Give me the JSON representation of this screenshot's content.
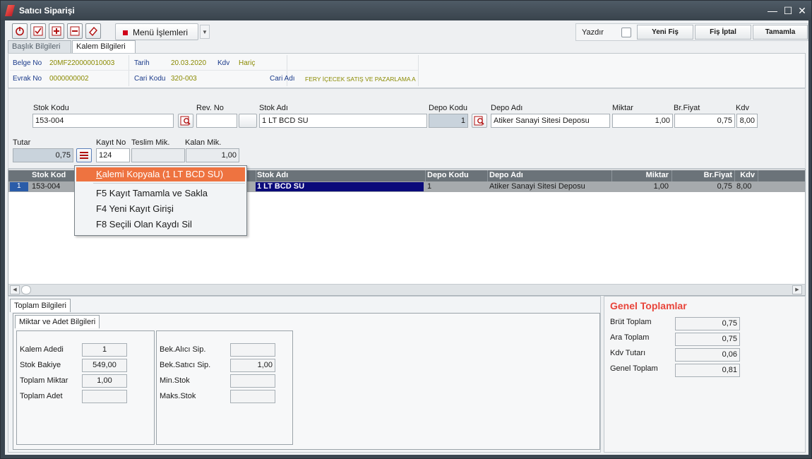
{
  "window": {
    "title": "Satıcı Siparişi",
    "minimize": "—",
    "maximize": "☐",
    "close": "✕"
  },
  "toolbar": {
    "menu_label": "Menü İşlemleri",
    "print_label": "Yazdır",
    "new_label": "Yeni Fiş",
    "cancel_label": "Fiş İptal",
    "complete_label": "Tamamla"
  },
  "tabs": [
    "Başlık Bilgileri",
    "Kalem Bilgileri"
  ],
  "header": {
    "belge_no_label": "Belge No",
    "belge_no": "20MF220000010003",
    "tarih_label": "Tarih",
    "tarih": "20.03.2020",
    "kdv_label": "Kdv",
    "kdv": "Hariç",
    "evrak_no_label": "Evrak No",
    "evrak_no": "0000000002",
    "cari_kodu_label": "Cari Kodu",
    "cari_kodu": "320-003",
    "cari_adi_label": "Cari Adı",
    "cari_adi": "FERY İÇECEK SATIŞ VE PAZARLAMA A"
  },
  "entry": {
    "stok_kodu_label": "Stok Kodu",
    "stok_kodu": "153-004",
    "rev_no_label": "Rev. No",
    "rev_no": "",
    "stok_adi_label": "Stok Adı",
    "stok_adi": "1 LT BCD SU",
    "depo_kodu_label": "Depo Kodu",
    "depo_kodu": "1",
    "depo_adi_label": "Depo Adı",
    "depo_adi": "Atiker Sanayi Sitesi Deposu",
    "miktar_label": "Miktar",
    "miktar": "1,00",
    "br_fiyat_label": "Br.Fiyat",
    "br_fiyat": "0,75",
    "kdv_label": "Kdv",
    "kdv": "8,00",
    "tutar_label": "Tutar",
    "tutar": "0,75",
    "kayit_no_label": "Kayıt No",
    "kayit_no": "124",
    "teslim_label": "Teslim Mik.",
    "teslim": "",
    "kalan_label": "Kalan Mik.",
    "kalan": "1,00"
  },
  "grid": {
    "columns": [
      "Stok Kod",
      "Stok Adı",
      "Depo Kodu",
      "Depo Adı",
      "Miktar",
      "Br.Fiyat",
      "Kdv"
    ],
    "rows": [
      {
        "num": "1",
        "stok_kodu": "153-004",
        "stok_adi": "1 LT BCD SU",
        "depo_kodu": "1",
        "depo_adi": "Atiker Sanayi Sitesi Deposu",
        "miktar": "1,00",
        "br_fiyat": "0,75",
        "kdv": "8,00"
      }
    ]
  },
  "context_menu": {
    "items": [
      {
        "key": "K",
        "label": "alemi Kopyala (1 LT BCD SU)"
      },
      {
        "key": "F5",
        "label": " Kayıt Tamamla ve Sakla"
      },
      {
        "key": "F4",
        "label": " Yeni Kayıt Girişi"
      },
      {
        "key": "F8",
        "label": " Seçili Olan Kaydı Sil"
      }
    ]
  },
  "bottom": {
    "tab": "Toplam Bilgileri",
    "subtab": "Miktar ve Adet Bilgileri",
    "left": [
      {
        "label": "Kalem Adedi",
        "value": "1"
      },
      {
        "label": "Stok Bakiye",
        "value": "549,00"
      },
      {
        "label": "Toplam Miktar",
        "value": "1,00"
      },
      {
        "label": "Toplam Adet",
        "value": ""
      }
    ],
    "right": [
      {
        "label": "Bek.Alıcı Sip.",
        "value": ""
      },
      {
        "label": "Bek.Satıcı Sip.",
        "value": "1,00"
      },
      {
        "label": "Min.Stok",
        "value": ""
      },
      {
        "label": "Maks.Stok",
        "value": ""
      }
    ]
  },
  "totals": {
    "title": "Genel Toplamlar",
    "items": [
      {
        "label": "Brüt Toplam",
        "value": "0,75"
      },
      {
        "label": "Ara Toplam",
        "value": "0,75"
      },
      {
        "label": "Kdv Tutarı",
        "value": "0,06"
      },
      {
        "label": "Genel Toplam",
        "value": "0,81"
      }
    ]
  },
  "colors": {
    "accent": "#ee7340",
    "title_red": "#e8443a",
    "selection": "#0a0a7a"
  }
}
